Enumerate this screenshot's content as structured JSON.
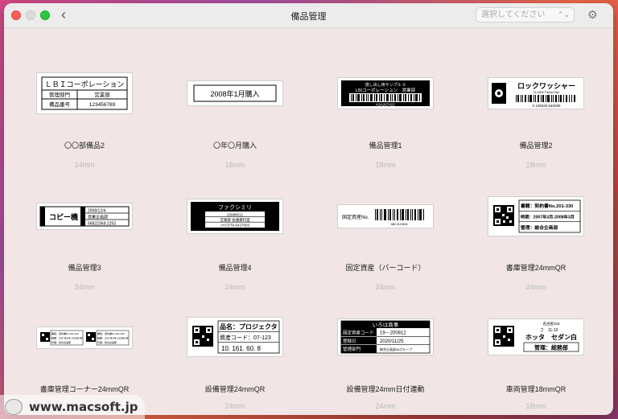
{
  "window": {
    "title": "備品管理"
  },
  "toolbar": {
    "select_placeholder": "選択してください"
  },
  "labels": [
    {
      "name": "〇〇部備品2",
      "size": "24mm"
    },
    {
      "name": "〇年〇月購入",
      "size": "18mm"
    },
    {
      "name": "備品管理1",
      "size": "18mm"
    },
    {
      "name": "備品管理2",
      "size": "18mm"
    },
    {
      "name": "備品管理3",
      "size": "24mm"
    },
    {
      "name": "備品管理4",
      "size": "24mm"
    },
    {
      "name": "固定資産（バーコード）",
      "size": "24mm"
    },
    {
      "name": "書庫管理24mmQR",
      "size": "24mm"
    },
    {
      "name": "書庫管理コーナー24mmQR",
      "size": "24mm"
    },
    {
      "name": "設備管理24mmQR",
      "size": "24mm"
    },
    {
      "name": "設備管理24mm日付連動",
      "size": "24mm"
    },
    {
      "name": "車両管理18mmQR",
      "size": "18mm"
    }
  ],
  "previews": {
    "p1": {
      "title": "ＬＢＩコーポレーション",
      "k1": "管理部門",
      "v1": "営業部",
      "k2": "備品番号",
      "v2": "123456789"
    },
    "p2": {
      "text": "2008年1月購入"
    },
    "p3": {
      "top": "貸し出し用サンプル ①",
      "bar": "LBIコーポレーション　営業部",
      "code": "K8A267422"
    },
    "p4": {
      "title": "ロックワッシャー",
      "sub": "16-3HW Thread Size",
      "code": "0 125020 540005"
    },
    "p5": {
      "main": "コピー機",
      "l1": "2008/12/4",
      "l2": "営業企画部",
      "l3": "56822368-2253"
    },
    "p6": {
      "head": "ファクシミリ",
      "l1": "2008/6/12",
      "l2": "営業部 会議資料室",
      "l3": "AYCP79-5427003"
    },
    "p7": {
      "label": "固定資産No.",
      "code": "ABC0123456"
    },
    "p8": {
      "l1": "書籍：契約書No.201-330",
      "l2": "時期：2007年3月-2008年3月",
      "l3": "管理：総合企画部"
    },
    "p9": {
      "a1": "書籍：契約書No.201-300",
      "a2": "時期：2007年4月-2008年3月",
      "a3": "管理：総合企画部"
    },
    "p10": {
      "l1": "品名：プロジェクタ",
      "l2": "資産コード：07-123",
      "l3": "10. 161. 60. 8"
    },
    "p11": {
      "head": "いろは商事",
      "k1": "固定資産コード",
      "v1": "19－200812",
      "k2": "登録日",
      "v2": "2020/11/25",
      "k3": "管理部門",
      "v3": "総合企画部45グループ"
    },
    "p12": {
      "top": "名古屋333",
      "mid": "さ　11-10",
      "name": "ホッタ　セダン白",
      "dept": "管理：総務部"
    }
  },
  "watermark": "www.macsoft.jp"
}
